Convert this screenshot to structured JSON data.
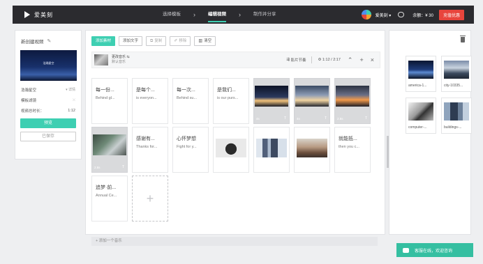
{
  "header": {
    "logo_text": "爱美刻",
    "steps": [
      "选择模板",
      "编辑视频",
      "制作并分享"
    ],
    "active_step": 1,
    "user_name": "爱美刻 ▾",
    "balance": "余额：¥ 30",
    "recharge_label": "充值优惠"
  },
  "left_panel": {
    "project_title": "新创建视频",
    "preview_caption": "浩瀚星空",
    "rows": [
      {
        "label": "浩瀚星空",
        "value": "▾ 详情"
      },
      {
        "label": "模板滤镜",
        "value": "⤫"
      },
      {
        "label": "视频总时长：",
        "value": "1:12"
      }
    ],
    "preview_button": "预览",
    "saved_button": "已保存"
  },
  "toolbar": {
    "add_material": "添加素材",
    "add_text": "添加文字",
    "copy": "复制",
    "remove": "移除",
    "clear": "清空"
  },
  "music_bar": {
    "change_music": "更改音乐 ⇆",
    "default_music": "默认音乐",
    "beat_label": "影片节奏",
    "time": "1:12 / 2:17"
  },
  "cards": [
    {
      "kind": "text",
      "title": "每一份...",
      "sub": "Behind gl..."
    },
    {
      "kind": "text",
      "title": "是每个...",
      "sub": "is everyon..."
    },
    {
      "kind": "text",
      "title": "每一次...",
      "sub": "Behind su..."
    },
    {
      "kind": "text",
      "title": "是我们...",
      "sub": "is our purs..."
    },
    {
      "kind": "media",
      "img": "img-city1",
      "dur": "4s"
    },
    {
      "kind": "media",
      "img": "img-city2",
      "dur": "4s"
    },
    {
      "kind": "media",
      "img": "img-city3",
      "dur": "2.8s"
    },
    {
      "kind": "media",
      "img": "img-office",
      "dur": "2.8s"
    },
    {
      "kind": "text",
      "title": "感谢有...",
      "sub": "Thanks for..."
    },
    {
      "kind": "text",
      "title": "心怀梦想",
      "sub": "Fight for y..."
    },
    {
      "kind": "photo",
      "img": "img-hands"
    },
    {
      "kind": "photo",
      "img": "img-towers"
    },
    {
      "kind": "photo",
      "img": "img-meeting"
    },
    {
      "kind": "text",
      "title": "就能抵...",
      "sub": "then you c..."
    },
    {
      "kind": "text",
      "title": "追梦·前...",
      "sub": "Annual Ce..."
    },
    {
      "kind": "add",
      "symbol": "+"
    }
  ],
  "add_music": "+ 添加一个音乐",
  "assets": [
    {
      "name": "america-1...",
      "img": "img-america"
    },
    {
      "name": "city-10335...",
      "img": "img-city4"
    },
    {
      "name": "computer-...",
      "img": "img-computer"
    },
    {
      "name": "buildings-...",
      "img": "img-buildings"
    }
  ],
  "support_label": "客服在线，欢迎咨询",
  "collapse_arrow": "›"
}
